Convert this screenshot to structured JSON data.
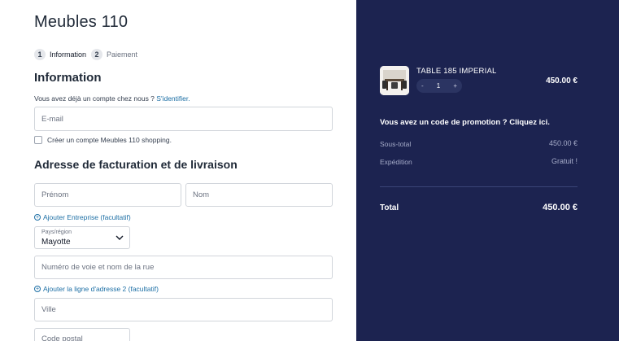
{
  "brand": {
    "title": "Meubles 110"
  },
  "steps": [
    {
      "num": "1",
      "label": "Information"
    },
    {
      "num": "2",
      "label": "Paiement"
    }
  ],
  "information": {
    "heading": "Information",
    "account_prompt": "Vous avez déjà un compte chez nous ?",
    "login_link": "S'identifier.",
    "email_placeholder": "E-mail",
    "create_account_label": "Créer un compte Meubles 110 shopping."
  },
  "address": {
    "heading": "Adresse de facturation et de livraison",
    "first_name_placeholder": "Prénom",
    "last_name_placeholder": "Nom",
    "add_company_link": "Ajouter Entreprise (facultatif)",
    "country_label": "Pays/région",
    "country_value": "Mayotte",
    "street_placeholder": "Numéro de voie et nom de la rue",
    "add_line2_link": "Ajouter la ligne d'adresse 2 (facultatif)",
    "city_placeholder": "Ville",
    "postal_placeholder": "Code postal"
  },
  "summary": {
    "product_name": "TABLE 185 IMPERIAL",
    "qty_minus": "-",
    "qty_value": "1",
    "qty_plus": "+",
    "product_price": "450.00 €",
    "promo_text": "Vous avez un code de promotion ? Cliquez ici.",
    "subtotal_label": "Sous-total",
    "subtotal_value": "450.00 €",
    "shipping_label": "Expédition",
    "shipping_value": "Gratuit !",
    "total_label": "Total",
    "total_value": "450.00 €"
  },
  "colors": {
    "summary_bg": "#1c2350",
    "link": "#1d6fa5"
  }
}
